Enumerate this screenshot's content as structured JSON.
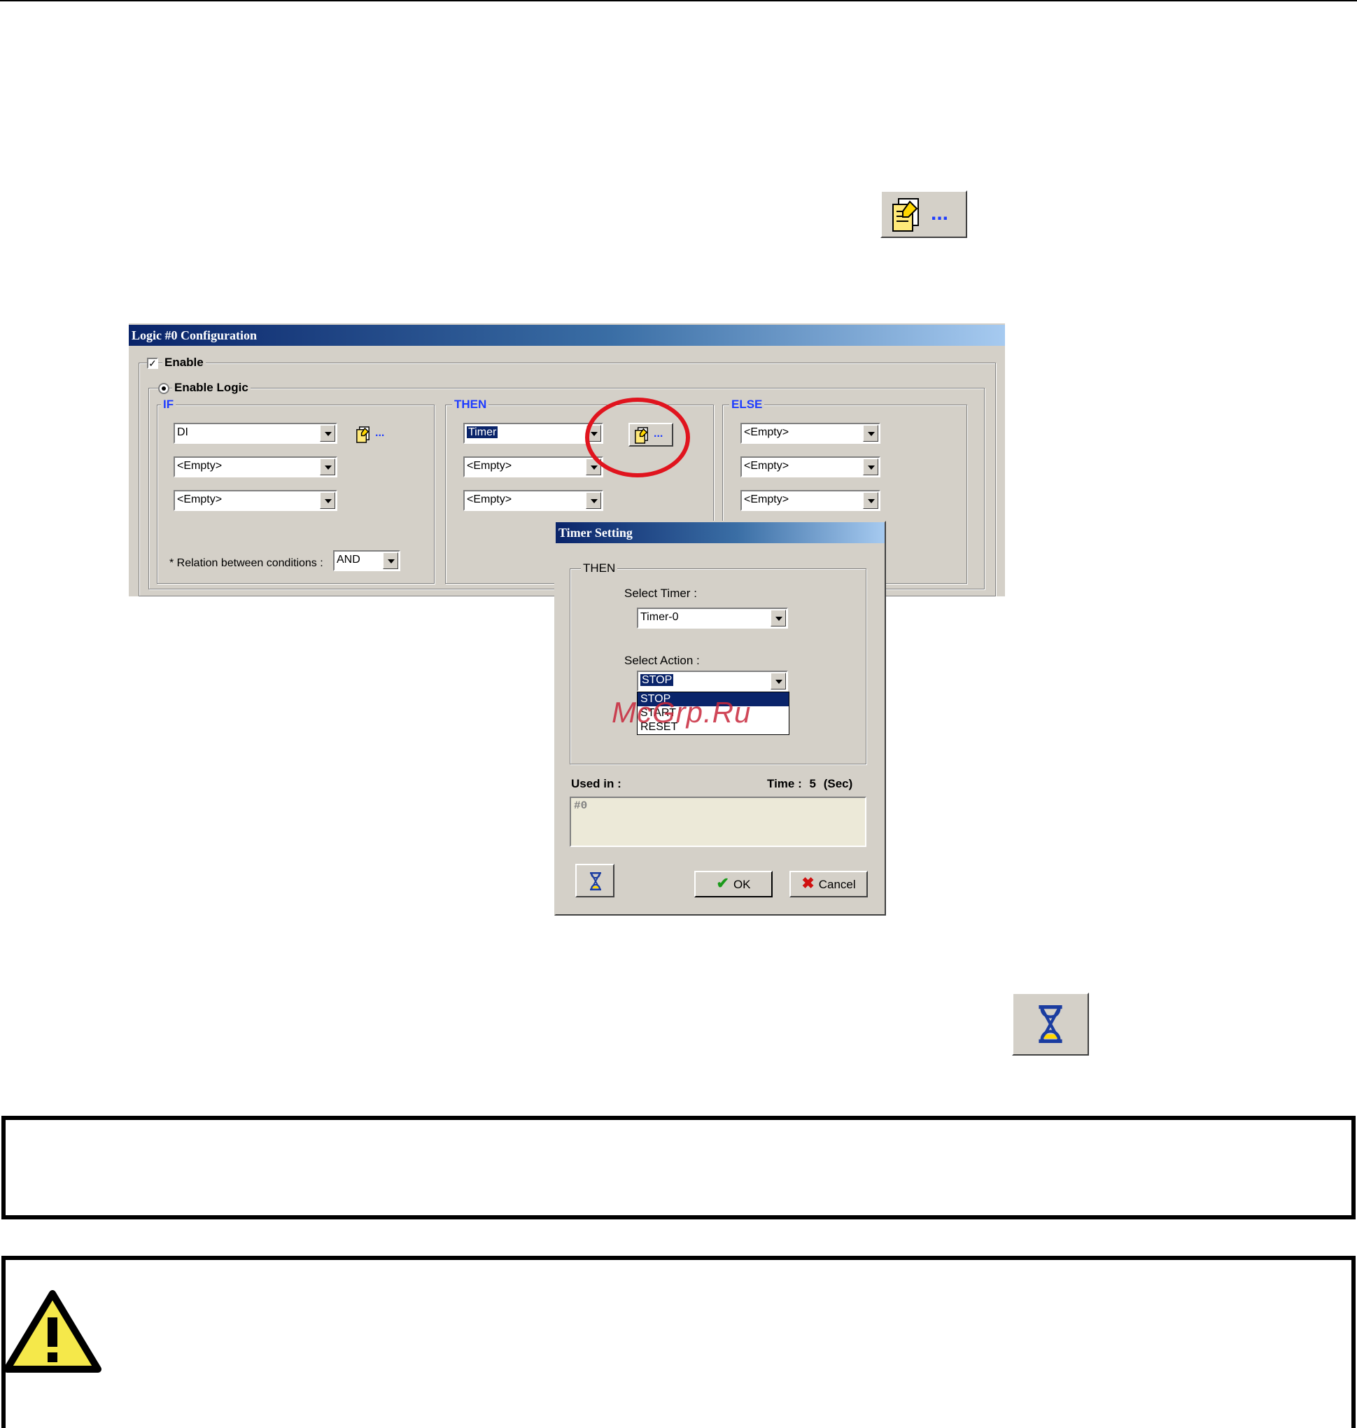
{
  "property_button": {
    "dots": "..."
  },
  "logic_dialog": {
    "title": "Logic #0 Configuration",
    "enable_label": "Enable",
    "enable_logic_label": "Enable Logic",
    "if_group": {
      "legend": "IF",
      "conditions": [
        "DI",
        "<Empty>",
        "<Empty>"
      ],
      "dots": "...",
      "relation_label": "* Relation between conditions :",
      "relation_value": "AND"
    },
    "then_group": {
      "legend": "THEN",
      "actions": [
        "Timer",
        "<Empty>",
        "<Empty>"
      ],
      "dots": "..."
    },
    "else_group": {
      "legend": "ELSE",
      "actions": [
        "<Empty>",
        "<Empty>",
        "<Empty>"
      ]
    }
  },
  "timer_dialog": {
    "title": "Timer Setting",
    "group_legend": "THEN",
    "select_timer_label": "Select Timer :",
    "select_timer_value": "Timer-0",
    "select_action_label": "Select Action :",
    "select_action_value": "STOP",
    "action_options": [
      "STOP",
      "START",
      "RESET"
    ],
    "used_in_label": "Used in :",
    "time_label": "Time :",
    "time_value": "5",
    "time_unit": "(Sec)",
    "used_in_value": "#0",
    "ok_label": "OK",
    "cancel_label": "Cancel"
  },
  "watermark": "McGrp.Ru",
  "colors": {
    "accent_red": "#e0141e",
    "title_blue": "#0a246a",
    "legend_blue": "#1e3cff",
    "warning_yellow": "#f5e84a"
  }
}
